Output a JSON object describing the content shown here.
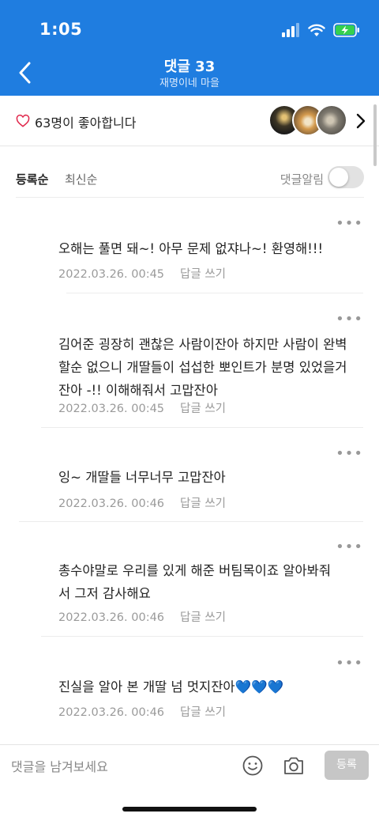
{
  "status_bar": {
    "time": "1:05"
  },
  "header": {
    "title": "댓글 33",
    "subtitle": "재명이네 마을"
  },
  "likes": {
    "text": "63명이 좋아합니다"
  },
  "sort": {
    "registered": "등록순",
    "latest": "최신순",
    "notify_label": "댓글알림",
    "notify_on": false
  },
  "comments": [
    {
      "text": "오해는 풀면 돼~! 아무 문제 없쟈나~! 환영해!!!",
      "date": "2022.03.26. 00:45",
      "reply": "답글 쓰기"
    },
    {
      "text": "김어준 굉장히 괜찮은 사람이잔아 하지만 사람이 완벽할순 없으니 개딸들이 섭섭한 뽀인트가 분명 있었을거잔아 -!! 이해해줘서 고맙잔아",
      "date": "2022.03.26. 00:45",
      "reply": "답글 쓰기"
    },
    {
      "text": "잉~ 개딸들 너무너무 고맙잔아",
      "date": "2022.03.26. 00:46",
      "reply": "답글 쓰기"
    },
    {
      "text": "총수야말로 우리를 있게 해준 버팀목이죠 알아봐줘서 그저 감사해요",
      "date": "2022.03.26. 00:46",
      "reply": "답글 쓰기"
    },
    {
      "text": "진실을 알아 본 개딸 넘 멋지잔아💙💙💙",
      "date": "2022.03.26. 00:46",
      "reply": "답글 쓰기"
    }
  ],
  "more_glyph": "•••",
  "input": {
    "placeholder": "댓글을 남겨보세요",
    "submit_label": "등록"
  },
  "colors": {
    "header_bg": "#1f7de0",
    "heart": "#e0264a",
    "muted": "#9a9a9a"
  },
  "icons": [
    "signal-icon",
    "wifi-icon",
    "battery-charging-icon",
    "back-arrow-icon",
    "heart-icon",
    "chevron-right-icon",
    "more-icon",
    "emoji-icon",
    "camera-icon"
  ]
}
